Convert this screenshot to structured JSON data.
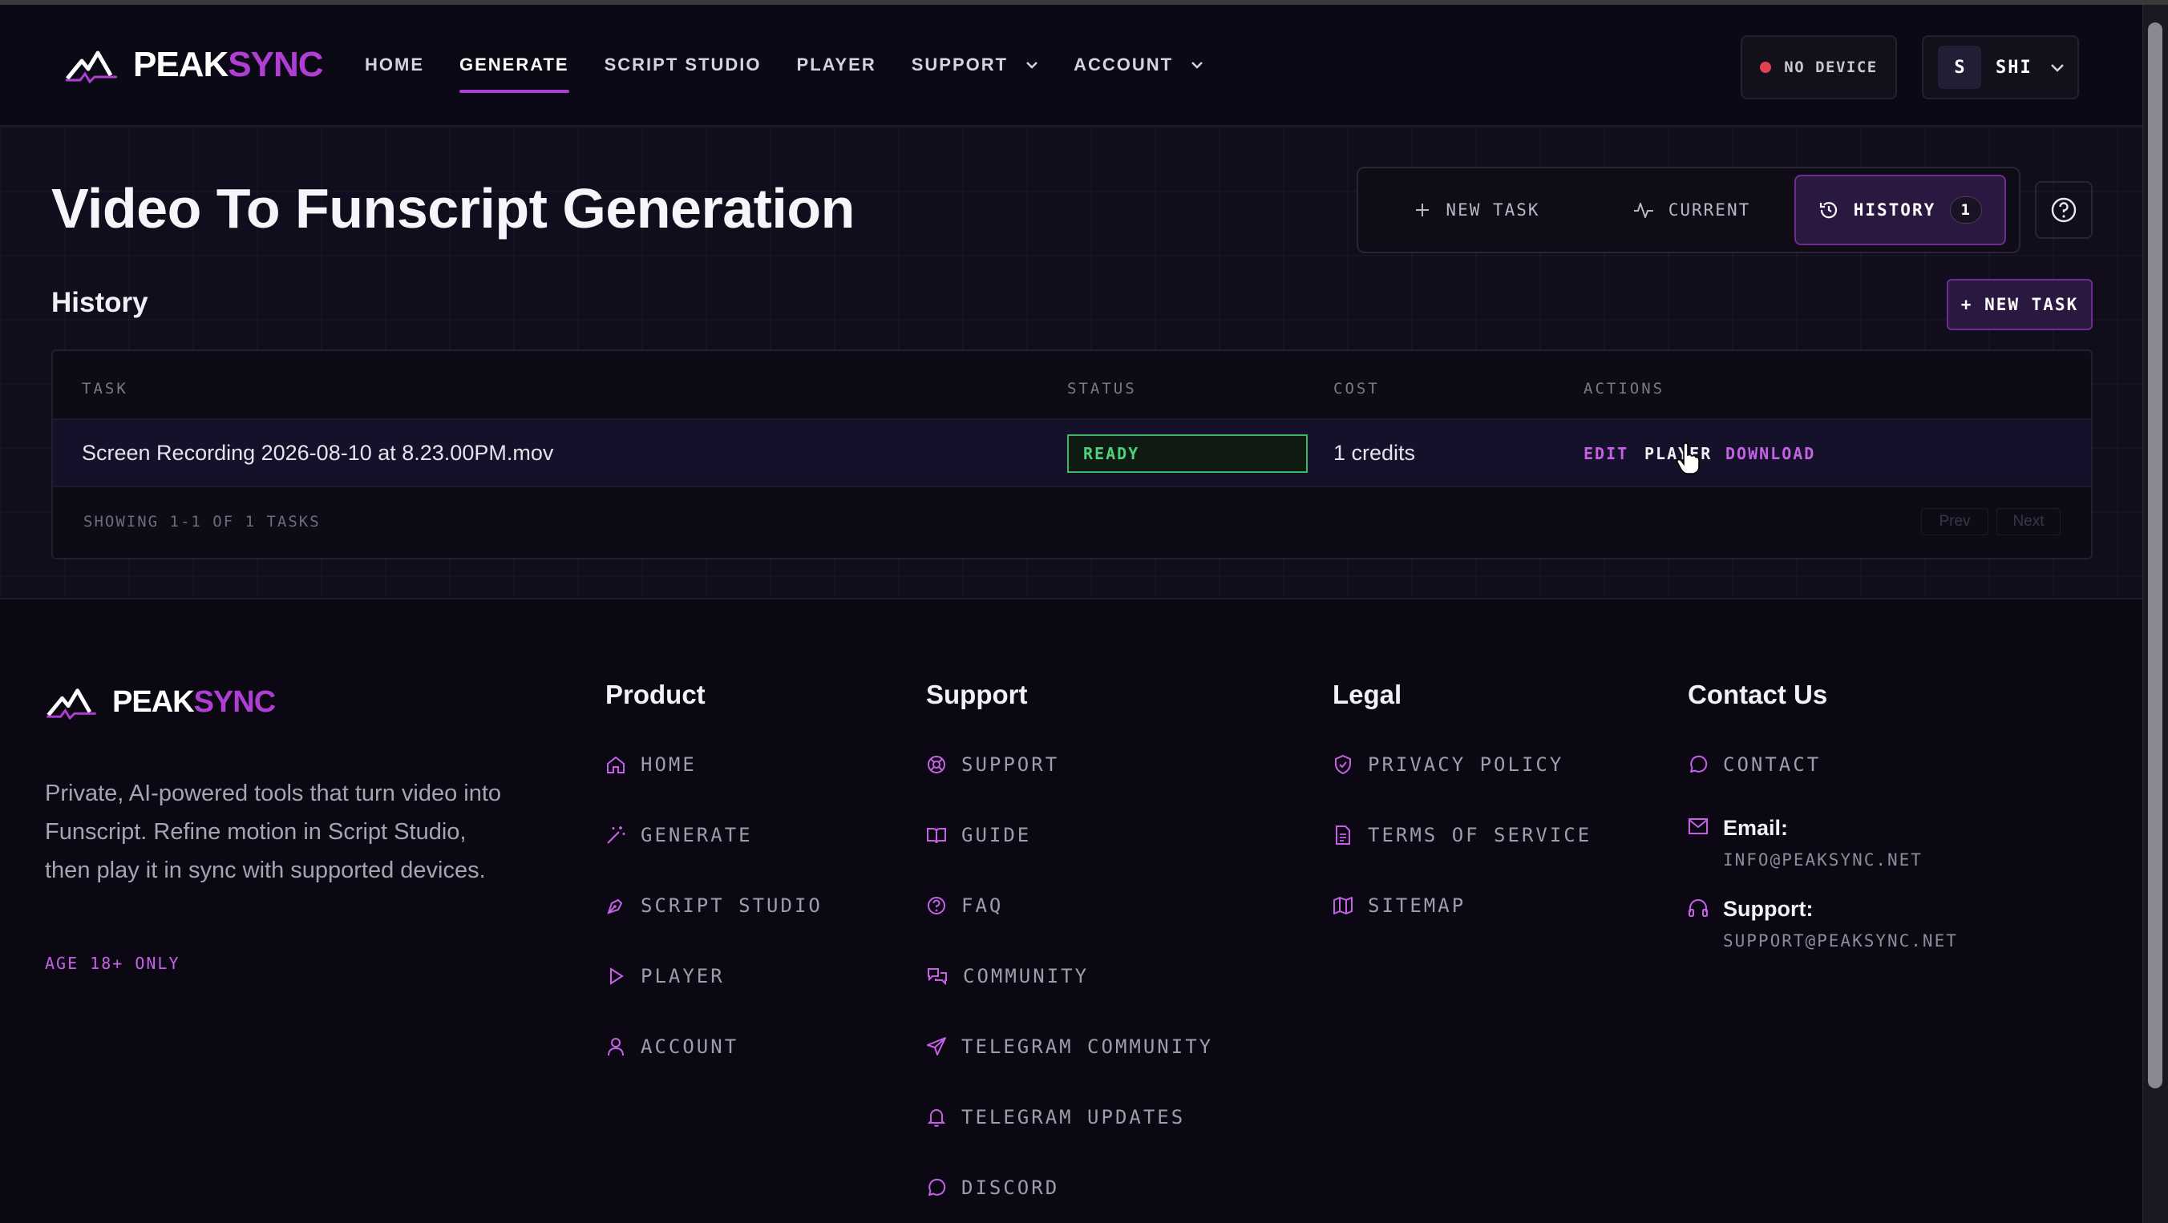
{
  "brand": {
    "name_a": "PEAK",
    "name_b": "SYNC"
  },
  "nav": {
    "home": "HOME",
    "generate": "GENERATE",
    "script_studio": "SCRIPT STUDIO",
    "player": "PLAYER",
    "support": "SUPPORT",
    "account": "ACCOUNT"
  },
  "header": {
    "device_status": "NO DEVICE",
    "avatar_initial": "S",
    "user_name": "SHI"
  },
  "page": {
    "title": "Video To Funscript Generation",
    "tabs": {
      "new_task": "NEW TASK",
      "current": "CURRENT",
      "history": "HISTORY",
      "history_count": "1"
    },
    "section_title": "History",
    "new_task_button": "+ NEW TASK"
  },
  "table": {
    "headers": {
      "task": "TASK",
      "status": "STATUS",
      "cost": "COST",
      "actions": "ACTIONS"
    },
    "rows": [
      {
        "task": "Screen Recording 2026-08-10 at 8.23.00PM.mov",
        "status": "READY",
        "cost": "1 credits",
        "actions": {
          "edit": "EDIT",
          "player": "PLAYER",
          "download": "DOWNLOAD"
        }
      }
    ],
    "summary": "SHOWING 1-1 OF 1 TASKS",
    "prev": "Prev",
    "next": "Next"
  },
  "footer": {
    "description": "Private, AI-powered tools that turn video into Funscript. Refine motion in Script Studio, then play it in sync with supported devices.",
    "age_notice": "AGE 18+ ONLY",
    "product": {
      "title": "Product",
      "links": [
        "HOME",
        "GENERATE",
        "SCRIPT STUDIO",
        "PLAYER",
        "ACCOUNT"
      ]
    },
    "support": {
      "title": "Support",
      "links": [
        "SUPPORT",
        "GUIDE",
        "FAQ",
        "COMMUNITY",
        "TELEGRAM COMMUNITY",
        "TELEGRAM UPDATES",
        "DISCORD"
      ]
    },
    "legal": {
      "title": "Legal",
      "links": [
        "PRIVACY POLICY",
        "TERMS OF SERVICE",
        "SITEMAP"
      ]
    },
    "contact": {
      "title": "Contact Us",
      "contact_link": "CONTACT",
      "email_label": "Email:",
      "email": "INFO@PEAKSYNC.NET",
      "support_label": "Support:",
      "support_email": "SUPPORT@PEAKSYNC.NET"
    }
  },
  "colors": {
    "accent": "#b13ed4",
    "ready": "#4fd17c",
    "background": "#0d0a17",
    "no_device_dot": "#e0424f"
  }
}
